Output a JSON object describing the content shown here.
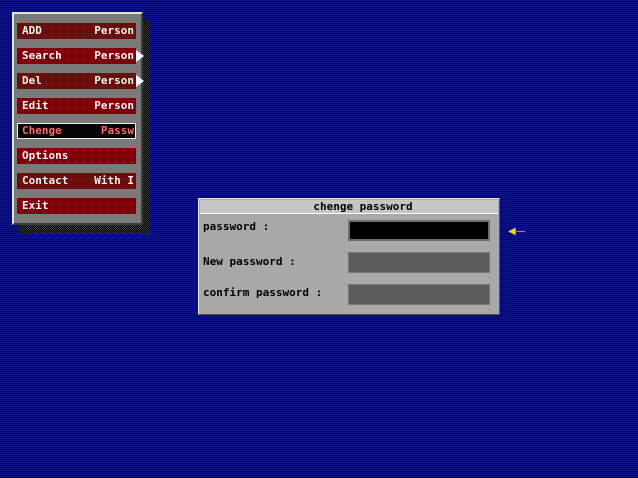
{
  "menu": {
    "items": [
      {
        "left": "ADD",
        "right": "Person",
        "has_submenu": false,
        "selected": false
      },
      {
        "left": "Search",
        "right": "Person",
        "has_submenu": true,
        "selected": false
      },
      {
        "left": "Del",
        "right": "Person",
        "has_submenu": true,
        "selected": false
      },
      {
        "left": "Edit",
        "right": "Person",
        "has_submenu": false,
        "selected": false
      },
      {
        "left": "Chenge",
        "right": "Passw",
        "has_submenu": false,
        "selected": true
      },
      {
        "left": "Options",
        "right": "",
        "has_submenu": false,
        "selected": false
      },
      {
        "left": "Contact",
        "right": "With I",
        "has_submenu": false,
        "selected": false
      },
      {
        "left": "Exit",
        "right": "",
        "has_submenu": false,
        "selected": false
      }
    ]
  },
  "dialog": {
    "title": "chenge password",
    "fields": [
      {
        "label": "password :",
        "value": "",
        "active": true
      },
      {
        "label": "New password :",
        "value": "",
        "active": false
      },
      {
        "label": "confirm password :",
        "value": "",
        "active": false
      }
    ]
  },
  "colors": {
    "background": "#0a0f7a",
    "menu_item": "#7a0606",
    "menu_selected_text": "#ff6a6a",
    "dialog_bg": "#a8a8a8",
    "input_bg": "#5c5c5c",
    "input_active_bg": "#000000",
    "cursor": "#f2d21a"
  },
  "icons": {
    "submenu_arrow": "triangle-right-icon",
    "mouse_cursor": "left-arrow-icon"
  }
}
